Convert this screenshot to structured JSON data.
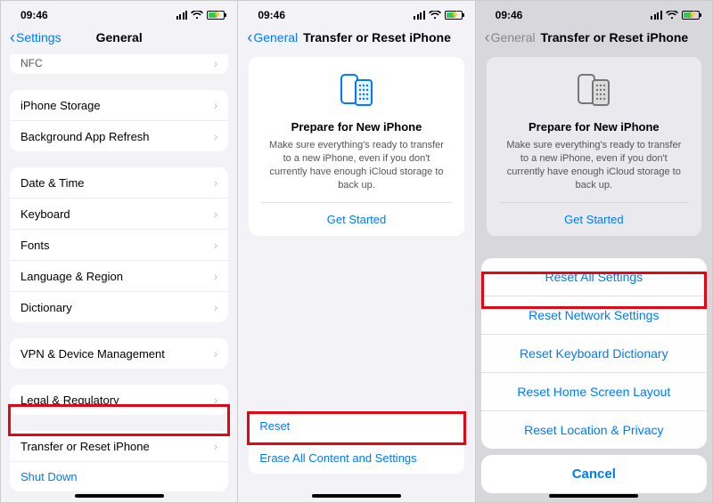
{
  "status": {
    "time": "09:46"
  },
  "panel1": {
    "back": "Settings",
    "title": "General",
    "group0": {
      "nfc": "NFC"
    },
    "group1": {
      "storage": "iPhone Storage",
      "bgRefresh": "Background App Refresh"
    },
    "group2": {
      "dateTime": "Date & Time",
      "keyboard": "Keyboard",
      "fonts": "Fonts",
      "langRegion": "Language & Region",
      "dictionary": "Dictionary"
    },
    "group3": {
      "vpn": "VPN & Device Management"
    },
    "group4": {
      "legal": "Legal & Regulatory"
    },
    "group5": {
      "transferReset": "Transfer or Reset iPhone",
      "shutDown": "Shut Down"
    }
  },
  "panel2": {
    "back": "General",
    "title": "Transfer or Reset iPhone",
    "card": {
      "heading": "Prepare for New iPhone",
      "body": "Make sure everything's ready to transfer to a new iPhone, even if you don't currently have enough iCloud storage to back up.",
      "cta": "Get Started"
    },
    "bottom": {
      "reset": "Reset",
      "erase": "Erase All Content and Settings"
    }
  },
  "panel3": {
    "back": "General",
    "title": "Transfer or Reset iPhone",
    "card": {
      "heading": "Prepare for New iPhone",
      "body": "Make sure everything's ready to transfer to a new iPhone, even if you don't currently have enough iCloud storage to back up.",
      "cta": "Get Started"
    },
    "sheet": {
      "opt1": "Reset All Settings",
      "opt2": "Reset Network Settings",
      "opt3": "Reset Keyboard Dictionary",
      "opt4": "Reset Home Screen Layout",
      "opt5": "Reset Location & Privacy",
      "cancel": "Cancel"
    }
  }
}
